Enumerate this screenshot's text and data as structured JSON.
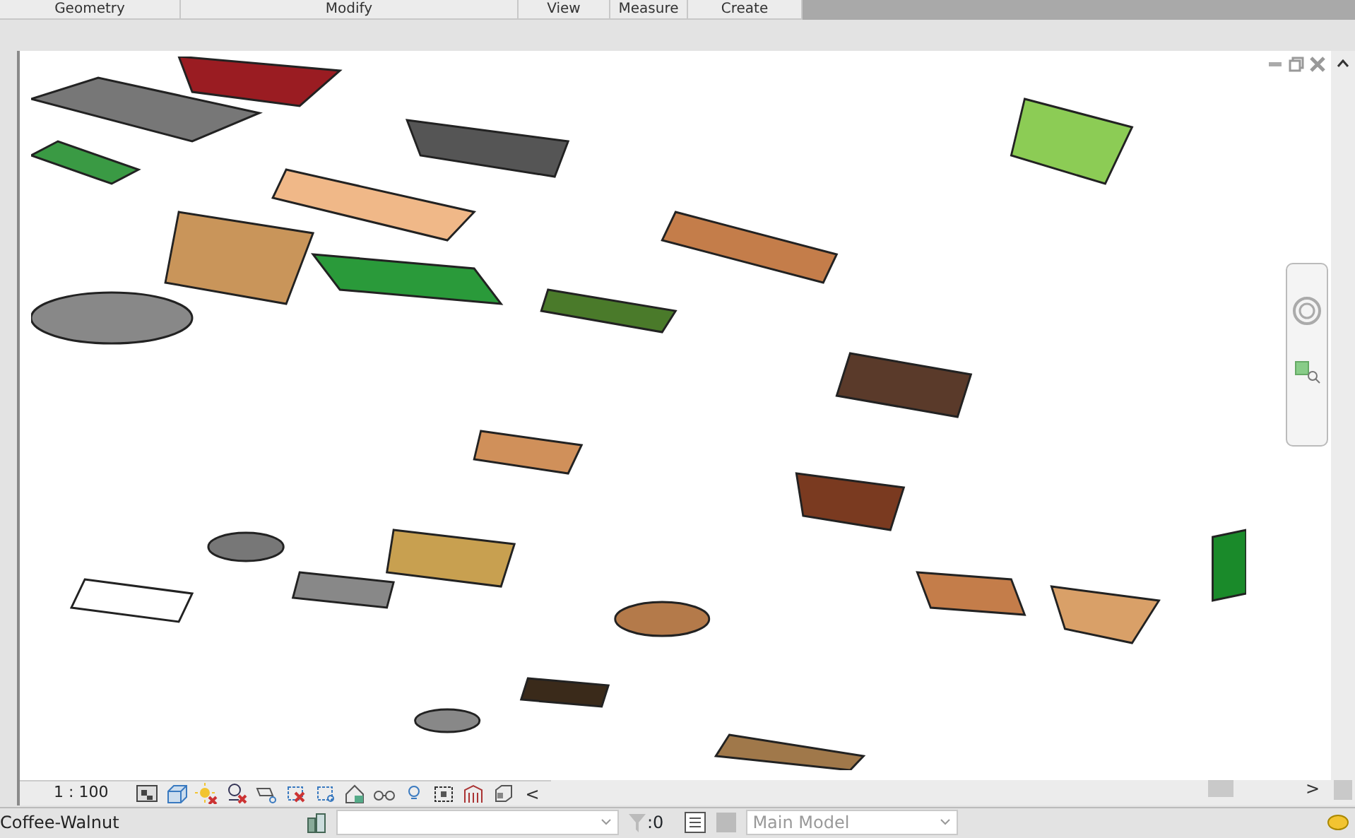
{
  "ribbon_panels": [
    {
      "label": "Geometry"
    },
    {
      "label": "Modify"
    },
    {
      "label": "View"
    },
    {
      "label": "Measure"
    },
    {
      "label": "Create"
    }
  ],
  "view_control_bar": {
    "scale": "1 : 100",
    "collapse": "<"
  },
  "horizontal_scrollbar": {
    "right_arrow": ">"
  },
  "status_bar": {
    "selection": "Coffee-Walnut",
    "count": ":0",
    "model": "Main Model"
  }
}
